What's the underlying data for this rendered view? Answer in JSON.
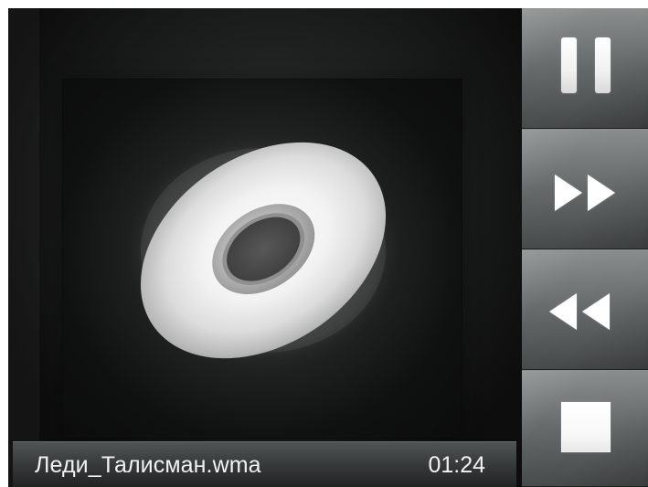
{
  "player": {
    "track_name": "Леди_Талисман.wma",
    "elapsed_time": "01:24"
  },
  "controls": [
    {
      "label": "Pause",
      "icon": "pause-icon"
    },
    {
      "label": "Fast Forward",
      "icon": "fast-forward-icon"
    },
    {
      "label": "Rewind",
      "icon": "rewind-icon"
    },
    {
      "label": "Stop",
      "icon": "stop-icon"
    }
  ],
  "colors": {
    "background": "#0d0d0d",
    "control_panel": "#5e6262",
    "text": "#f2f2f2",
    "icon": "#ffffff"
  }
}
